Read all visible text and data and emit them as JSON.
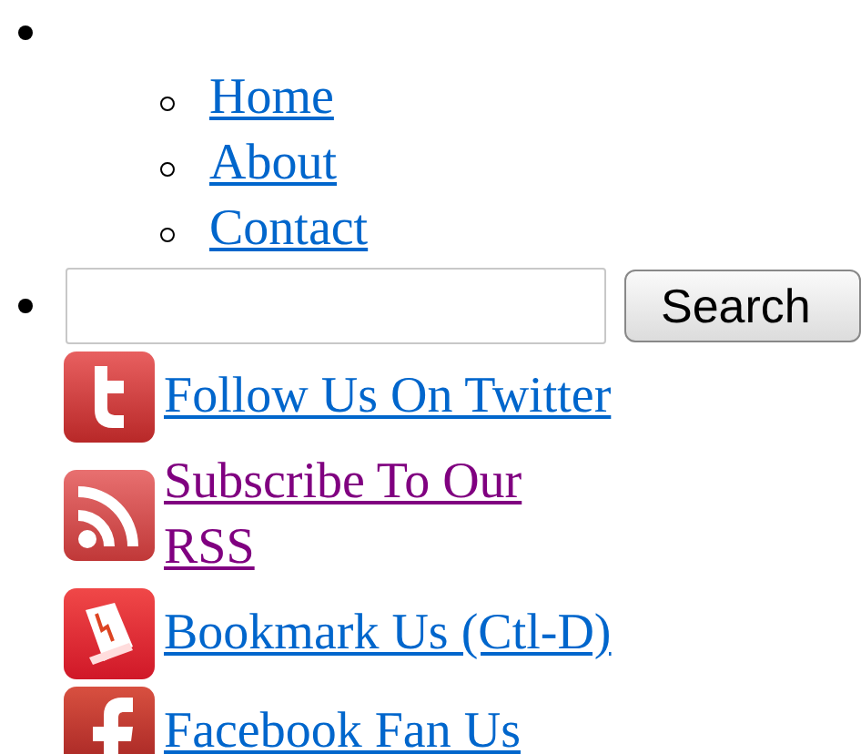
{
  "menu": {
    "items": [
      {
        "label": "Home",
        "visited": false
      },
      {
        "label": "About",
        "visited": false
      },
      {
        "label": "Contact",
        "visited": false
      }
    ]
  },
  "search": {
    "button": "Search"
  },
  "social_links": [
    {
      "kind": "twitter",
      "label": "Follow Us On Twitter",
      "visited": false
    },
    {
      "kind": "rss",
      "label": "Subscribe To Our RSS",
      "visited": true
    },
    {
      "kind": "bookmark",
      "label": "Bookmark Us (Ctl-D)",
      "visited": false
    },
    {
      "kind": "facebook",
      "label": "Facebook Fan Us",
      "visited": false
    }
  ]
}
